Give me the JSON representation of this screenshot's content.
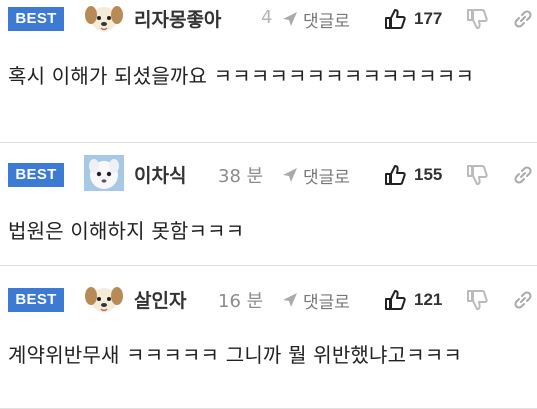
{
  "comments": [
    {
      "badge": "BEST",
      "author": "리자몽좋아",
      "time": "4",
      "reply_label": "댓글로",
      "likes": "177",
      "text": "혹시 이해가 되셨을까요 ㅋㅋㅋㅋㅋㅋㅋㅋㅋㅋㅋㅋㅋㅋ",
      "avatar_icon": "puppy-avatar"
    },
    {
      "badge": "BEST",
      "author": "이차식",
      "time": "38 분",
      "reply_label": "댓글로",
      "likes": "155",
      "text": "법원은 이해하지 못함ㅋㅋㅋ",
      "avatar_icon": "white-creature-avatar"
    },
    {
      "badge": "BEST",
      "author": "살인자",
      "time": "16 분",
      "reply_label": "댓글로",
      "likes": "121",
      "text": "계약위반무새 ㅋㅋㅋㅋㅋ 그니까 뭘 위반했냐고ㅋㅋㅋ",
      "avatar_icon": "puppy-avatar"
    }
  ],
  "colors": {
    "badge_bg": "#3d7ad4",
    "separator": "#e1e1e1",
    "muted_text": "#8c8c8c"
  }
}
